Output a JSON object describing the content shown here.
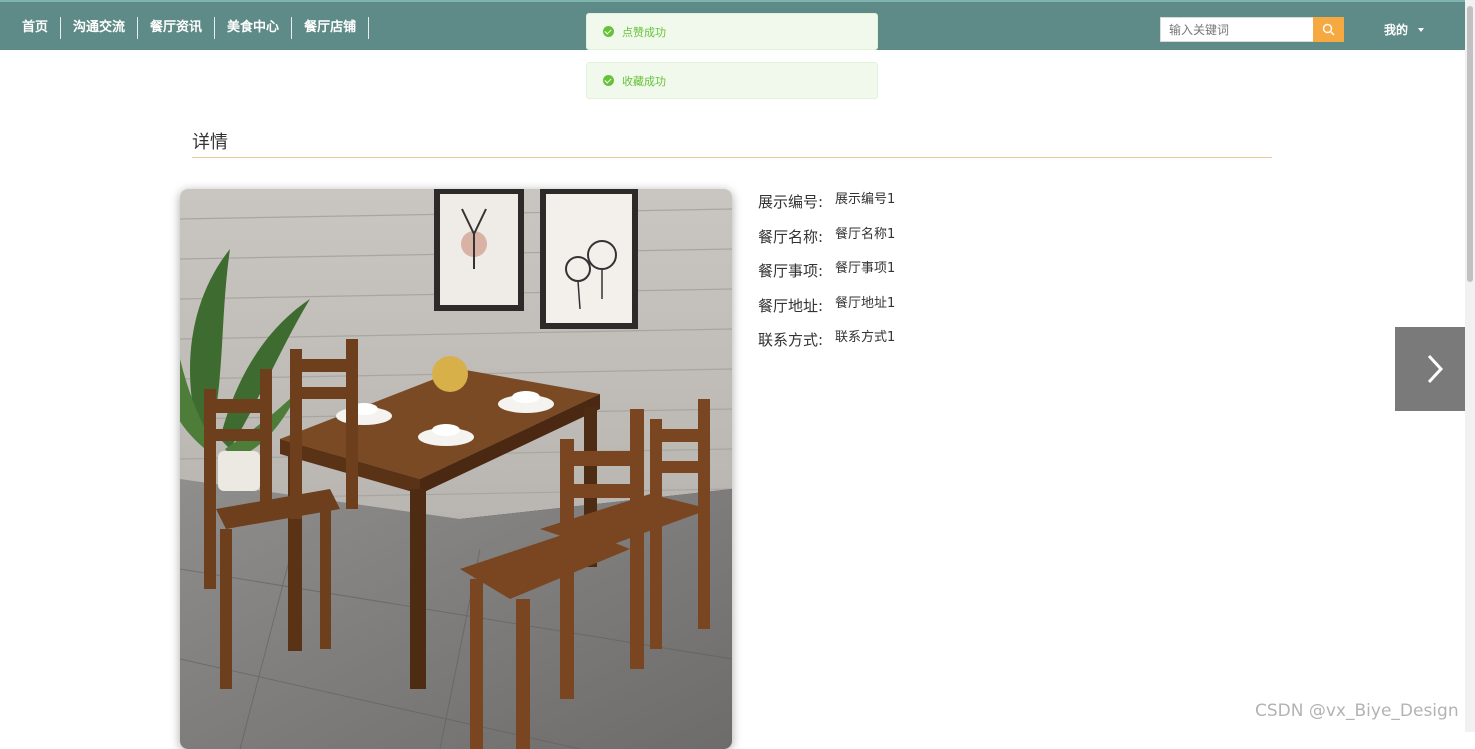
{
  "nav": {
    "items": [
      {
        "label": "首页"
      },
      {
        "label": "沟通交流"
      },
      {
        "label": "餐厅资讯"
      },
      {
        "label": "美食中心"
      },
      {
        "label": "餐厅店铺"
      }
    ]
  },
  "search": {
    "placeholder": "输入关键词",
    "icon": "search-icon"
  },
  "user_menu": {
    "label": "我的"
  },
  "toasts": [
    {
      "text": "点赞成功",
      "type": "success"
    },
    {
      "text": "收藏成功",
      "type": "success"
    }
  ],
  "section": {
    "title": "详情"
  },
  "details": [
    {
      "label": "展示编号:",
      "value": "展示编号1"
    },
    {
      "label": "餐厅名称:",
      "value": "餐厅名称1"
    },
    {
      "label": "餐厅事项:",
      "value": "餐厅事项1"
    },
    {
      "label": "餐厅地址:",
      "value": "餐厅地址1"
    },
    {
      "label": "联系方式:",
      "value": "联系方式1"
    }
  ],
  "watermark": "CSDN @vx_Biye_Design",
  "colors": {
    "nav_bg": "#5e8b87",
    "search_btn": "#f6a940",
    "toast_bg": "#f0f9eb",
    "toast_text": "#67c23a",
    "divider": "#e8c99b"
  }
}
